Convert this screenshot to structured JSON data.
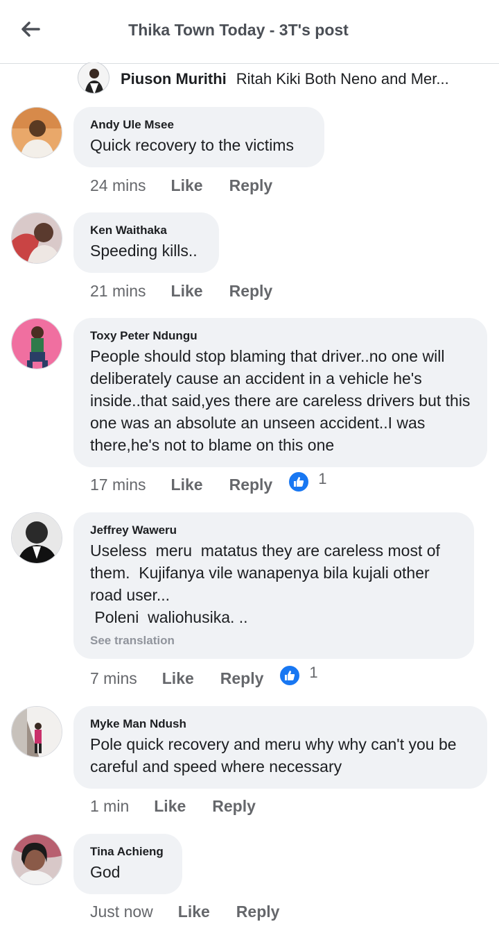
{
  "header": {
    "title": "Thika Town Today - 3T's post",
    "back_icon": "back-arrow-icon"
  },
  "reply_preview": {
    "name": "Piuson Murithi",
    "text": "Ritah Kiki Both Neno and Mer..."
  },
  "comments": [
    {
      "author": "Andy Ule Msee",
      "text": "Quick recovery to the victims",
      "time": "24 mins",
      "like": "Like",
      "reply": "Reply"
    },
    {
      "author": "Ken Waithaka",
      "text": "Speeding kills..",
      "time": "21 mins",
      "like": "Like",
      "reply": "Reply"
    },
    {
      "author": "Toxy Peter Ndungu",
      "text": "People should stop blaming that driver..no one will deliberately cause an accident in a vehicle he's inside..that said,yes there are careless drivers but this one was an absolute an unseen accident..I was there,he's not to blame on this one",
      "time": "17 mins",
      "like": "Like",
      "reply": "Reply",
      "reaction_count": "1"
    },
    {
      "author": "Jeffrey Waweru",
      "text": "Useless  meru  matatus they are careless most of them.  Kujifanya vile wanapenya bila kujali other road user...\n Poleni  waliohusika. ..",
      "see_translation": "See translation",
      "time": "7 mins",
      "like": "Like",
      "reply": "Reply",
      "reaction_count": "1"
    },
    {
      "author": "Myke Man Ndush",
      "text": "Pole quick recovery and meru why why can't you be careful and speed where necessary",
      "time": "1 min",
      "like": "Like",
      "reply": "Reply"
    },
    {
      "author": "Tina Achieng",
      "text": "God",
      "time": "Just now",
      "like": "Like",
      "reply": "Reply"
    }
  ],
  "colors": {
    "bubble": "#f0f2f5",
    "like_blue": "#1877f2",
    "meta_gray": "#65676b"
  }
}
